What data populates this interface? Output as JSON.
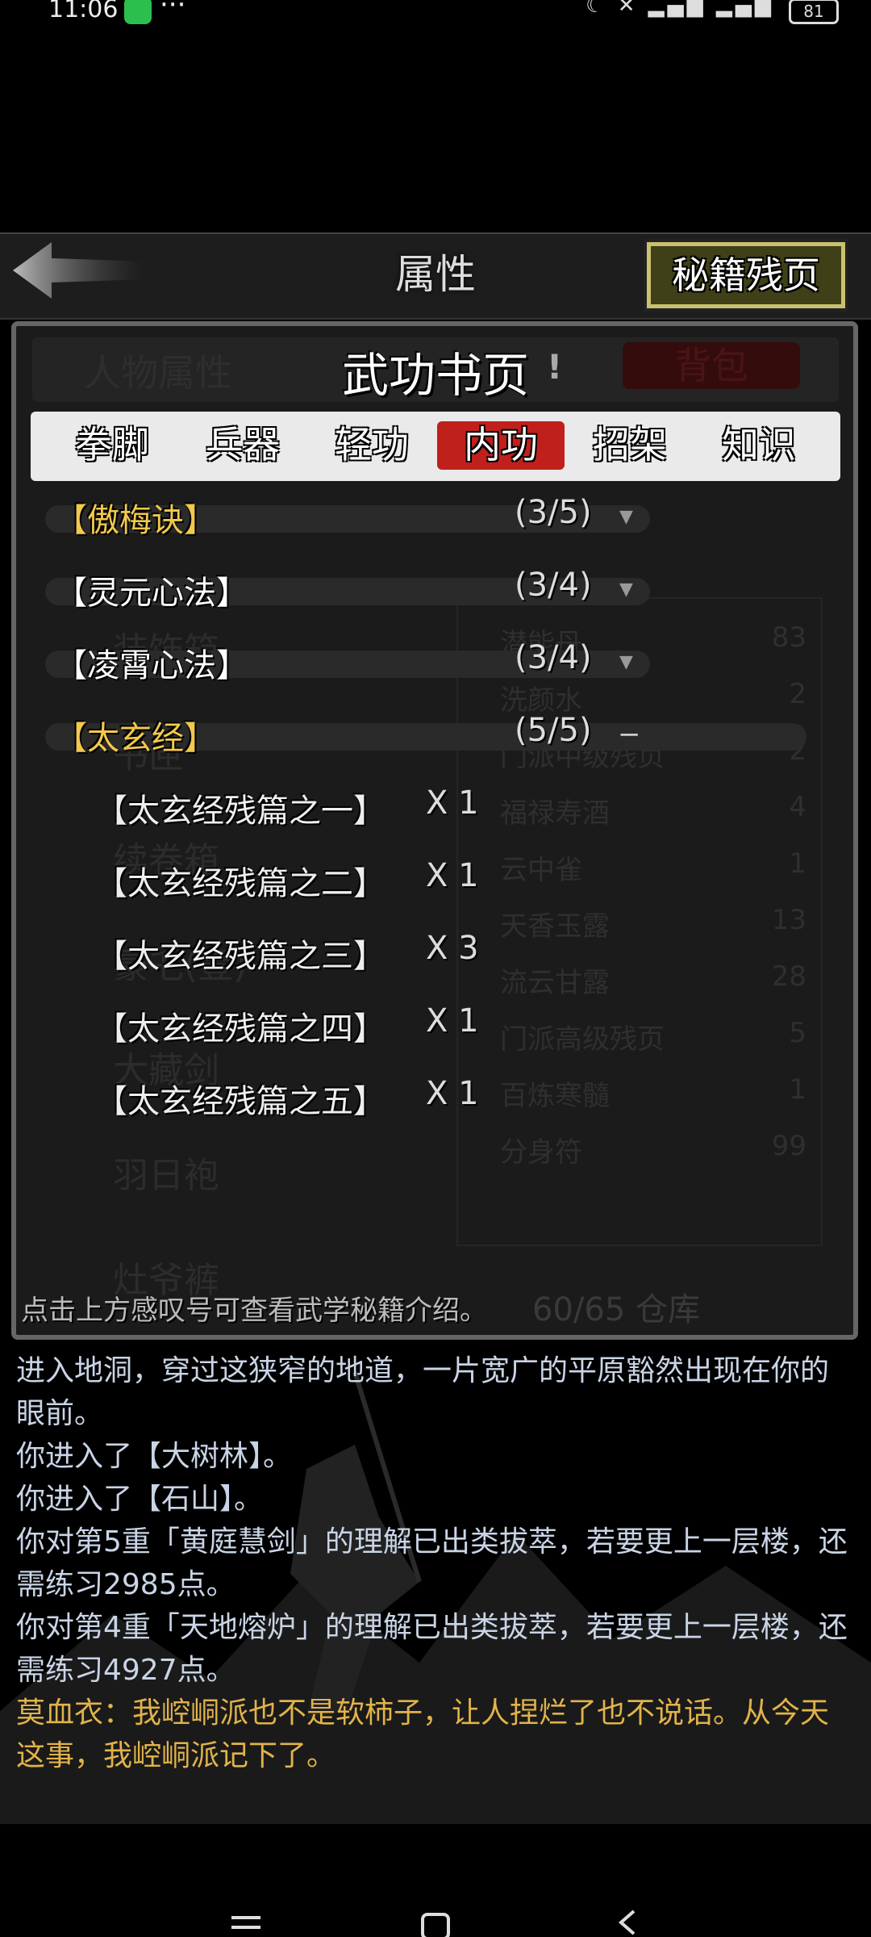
{
  "status_bar": {
    "time": "11:06",
    "more": "···",
    "battery": "81"
  },
  "header": {
    "title": "属性",
    "fragment_button": "秘籍残页"
  },
  "background_panel": {
    "tab_left": "人物属性",
    "tab_right": "背包",
    "items": [
      {
        "name": "潜能丹",
        "count": "83"
      },
      {
        "name": "洗颜水",
        "count": "2"
      },
      {
        "name": "门派中级残页",
        "count": "2"
      },
      {
        "name": "福禄寿酒",
        "count": "4"
      },
      {
        "name": "云中雀",
        "count": "1"
      },
      {
        "name": "天香玉露",
        "count": "13"
      },
      {
        "name": "流云甘露",
        "count": "28"
      },
      {
        "name": "门派高级残页",
        "count": "5"
      },
      {
        "name": "百炼寒髓",
        "count": "1"
      },
      {
        "name": "分身符",
        "count": "99"
      }
    ],
    "left_items": [
      "装饰箱",
      "书匣",
      "续卷箱",
      "豪乇(壹)",
      "大藏剑",
      "羽日袍",
      "灶爷裤"
    ],
    "capacity": "60/65 仓库"
  },
  "popup": {
    "title": "武功书页",
    "exclaim": "!",
    "tabs": [
      "拳脚",
      "兵器",
      "轻功",
      "内功",
      "招架",
      "知识"
    ],
    "active_tab": "内功",
    "techniques": [
      {
        "name": "【傲梅诀】",
        "count": "(3/5)",
        "color": "#f2c94c",
        "expanded": false
      },
      {
        "name": "【灵元心法】",
        "count": "(3/4)",
        "color": "#ffffff",
        "expanded": false
      },
      {
        "name": "【凌霄心法】",
        "count": "(3/4)",
        "color": "#ffffff",
        "expanded": false
      },
      {
        "name": "【太玄经】",
        "count": "(5/5)",
        "color": "#f2c94c",
        "expanded": true
      }
    ],
    "fragments": [
      {
        "name": "【太玄经残篇之一】",
        "qty": "X 1"
      },
      {
        "name": "【太玄经残篇之二】",
        "qty": "X 1"
      },
      {
        "name": "【太玄经残篇之三】",
        "qty": "X 3"
      },
      {
        "name": "【太玄经残篇之四】",
        "qty": "X 1"
      },
      {
        "name": "【太玄经残篇之五】",
        "qty": "X 1"
      }
    ],
    "hint": "点击上方感叹号可查看武学秘籍介绍。"
  },
  "log": [
    {
      "text": "进入地洞，穿过这狭窄的地道，一片宽广的平原豁然出现在你的眼前。",
      "style": "normal"
    },
    {
      "text": "你进入了【大树林】。",
      "style": "normal"
    },
    {
      "text": "你进入了【石山】。",
      "style": "normal"
    },
    {
      "text": "你对第5重「黄庭慧剑」的理解已出类拔萃，若要更上一层楼，还需练习2985点。",
      "style": "normal"
    },
    {
      "text": "你对第4重「天地熔炉」的理解已出类拔萃，若要更上一层楼，还需练习4927点。",
      "style": "normal"
    },
    {
      "text": "莫血衣：我崆峒派也不是软柿子，让人捏烂了也不说话。从今天这事，我崆峒派记下了。",
      "style": "yellow"
    }
  ],
  "colors": {
    "accent_red": "#c0201c",
    "gold": "#f2c94c",
    "button_border": "#c8c26e",
    "log_text": "#c9d4e6",
    "log_yellow": "#e1b34a"
  }
}
